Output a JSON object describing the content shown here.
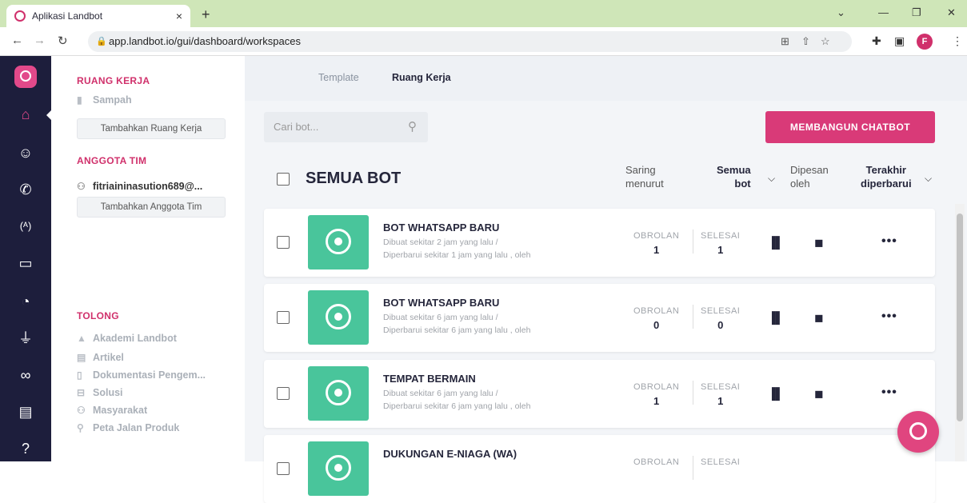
{
  "browser": {
    "tab_title": "Aplikasi Landbot",
    "tab_close": "×",
    "new_tab": "+",
    "url": "app.landbot.io/gui/dashboard/workspaces",
    "profile_initial": "F"
  },
  "sidebar": {
    "workspace_heading": "RUANG KERJA",
    "trash_label": "Sampah",
    "add_workspace_button": "Tambahkan Ruang Kerja",
    "team_heading": "ANGGOTA TIM",
    "member_email": "fitriaininasution689@...",
    "add_member_button": "Tambahkan Anggota Tim",
    "help_heading": "TOLONG",
    "help_links": [
      {
        "label": "Akademi Landbot",
        "icon": "graduation-cap-icon"
      },
      {
        "label": "Artikel",
        "icon": "article-icon"
      },
      {
        "label": "Dokumentasi Pengem...",
        "icon": "document-icon"
      },
      {
        "label": "Solusi",
        "icon": "solution-icon"
      },
      {
        "label": "Masyarakat",
        "icon": "community-icon"
      },
      {
        "label": "Peta Jalan Produk",
        "icon": "roadmap-icon"
      }
    ]
  },
  "topnav": {
    "tabs": [
      "Template",
      "Ruang Kerja"
    ],
    "active_tab": "Ruang Kerja"
  },
  "toolbar": {
    "search_placeholder": "Cari bot...",
    "build_button": "MEMBANGUN CHATBOT"
  },
  "list": {
    "title": "SEMUA BOT",
    "filter_label_1": "Saring",
    "filter_label_2": "menurut",
    "filter_value_1": "Semua",
    "filter_value_2": "bot",
    "sort_label_1": "Dipesan",
    "sort_label_2": "oleh",
    "sort_value_1": "Terakhir",
    "sort_value_2": "diperbarui"
  },
  "bots": [
    {
      "name": "BOT WHATSAPP BARU",
      "created": "Dibuat sekitar 2 jam yang lalu /",
      "updated": "Diperbarui sekitar 1 jam yang lalu , oleh",
      "chats_label": "OBROLAN",
      "chats": "1",
      "done_label": "SELESAI",
      "done": "1",
      "more": "•••"
    },
    {
      "name": "BOT WHATSAPP BARU",
      "created": "Dibuat sekitar 6 jam yang lalu /",
      "updated": "Diperbarui sekitar 6 jam yang lalu , oleh",
      "chats_label": "OBROLAN",
      "chats": "0",
      "done_label": "SELESAI",
      "done": "0",
      "more": "•••"
    },
    {
      "name": "TEMPAT BERMAIN",
      "created": "Dibuat sekitar 6 jam yang lalu /",
      "updated": "Diperbarui sekitar 6 jam yang lalu , oleh",
      "chats_label": "OBROLAN",
      "chats": "1",
      "done_label": "SELESAI",
      "done": "1",
      "more": "•••"
    },
    {
      "name": "DUKUNGAN E-NIAGA (WA)",
      "created": "",
      "updated": "",
      "chats_label": "OBROLAN",
      "chats": "",
      "done_label": "SELESAI",
      "done": "",
      "more": ""
    }
  ],
  "colors": {
    "accent": "#d93a78",
    "rail": "#1d1e3c",
    "whatsapp": "#49c59b"
  }
}
